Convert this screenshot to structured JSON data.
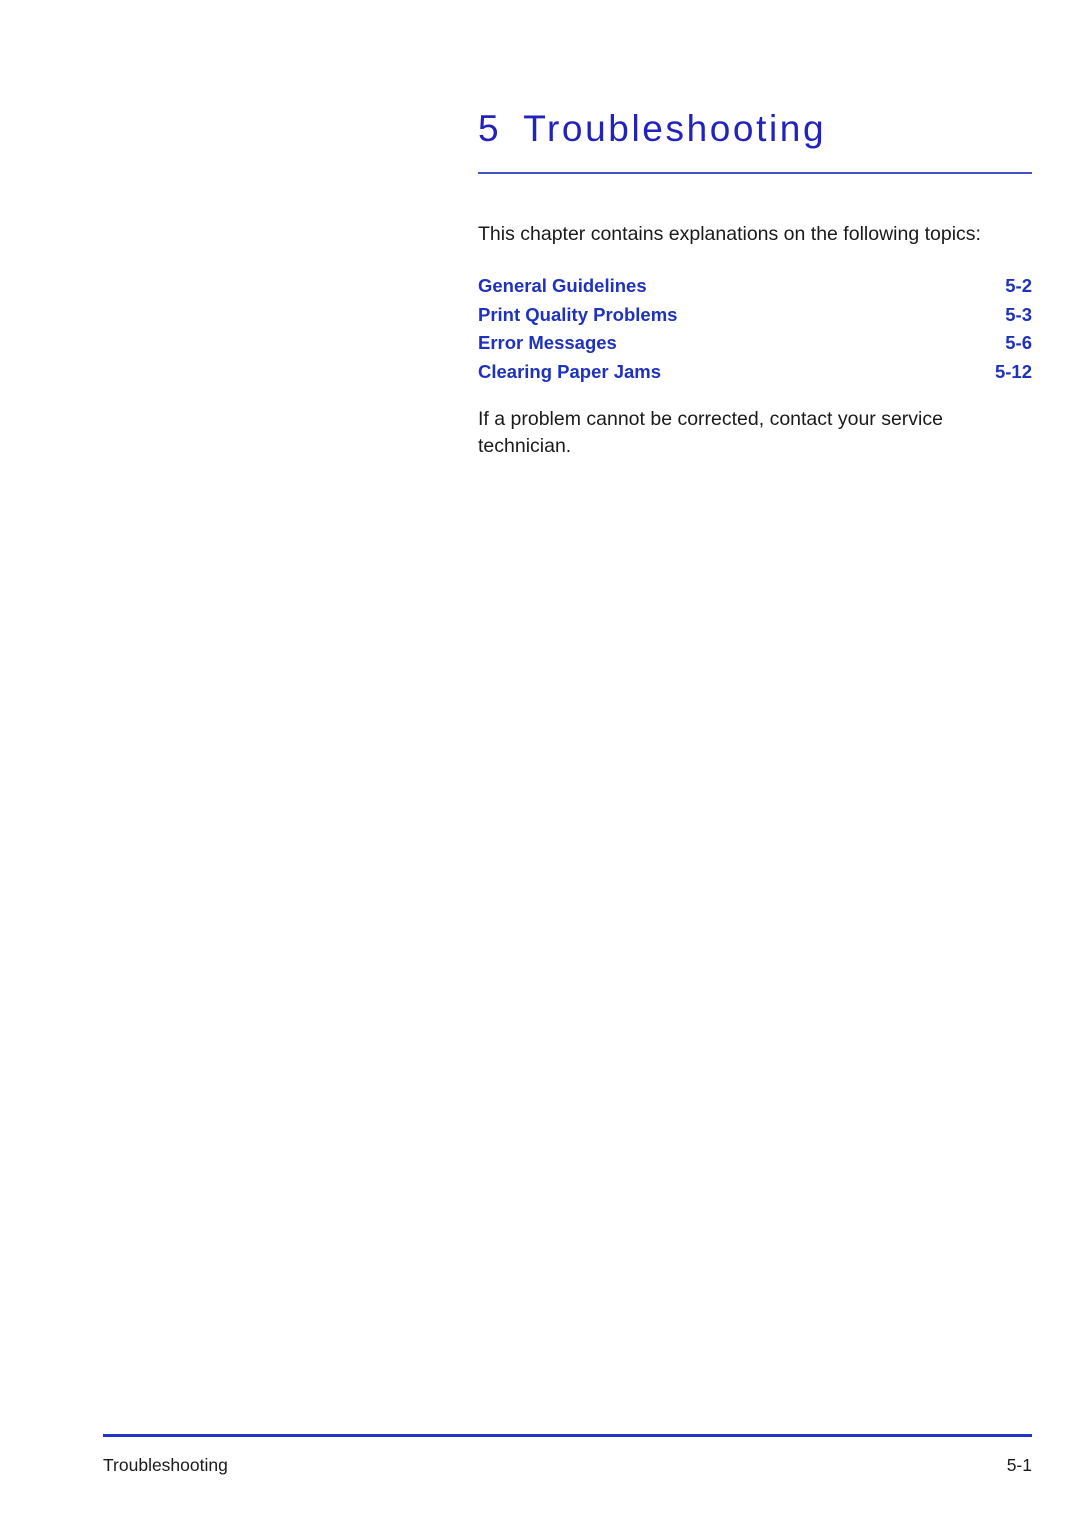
{
  "document": {
    "chapter": {
      "number": "5",
      "title": "Troubleshooting"
    },
    "intro_text": "This chapter contains explanations on the following topics:",
    "topics": [
      {
        "label": "General Guidelines",
        "page": "5-2"
      },
      {
        "label": "Print Quality Problems",
        "page": "5-3"
      },
      {
        "label": "Error Messages",
        "page": "5-6"
      },
      {
        "label": "Clearing Paper Jams",
        "page": "5-12"
      }
    ],
    "closing_text": "If a problem cannot be corrected, contact your service technician.",
    "footer": {
      "left": "Troubleshooting",
      "right": "5-1"
    },
    "colors": {
      "heading_blue": "#2222BD",
      "topic_blue": "#1F32BE",
      "chapter_rule": "#4452CA",
      "footer_rule": "#2233CC",
      "body_text": "#1A1A1A"
    }
  }
}
